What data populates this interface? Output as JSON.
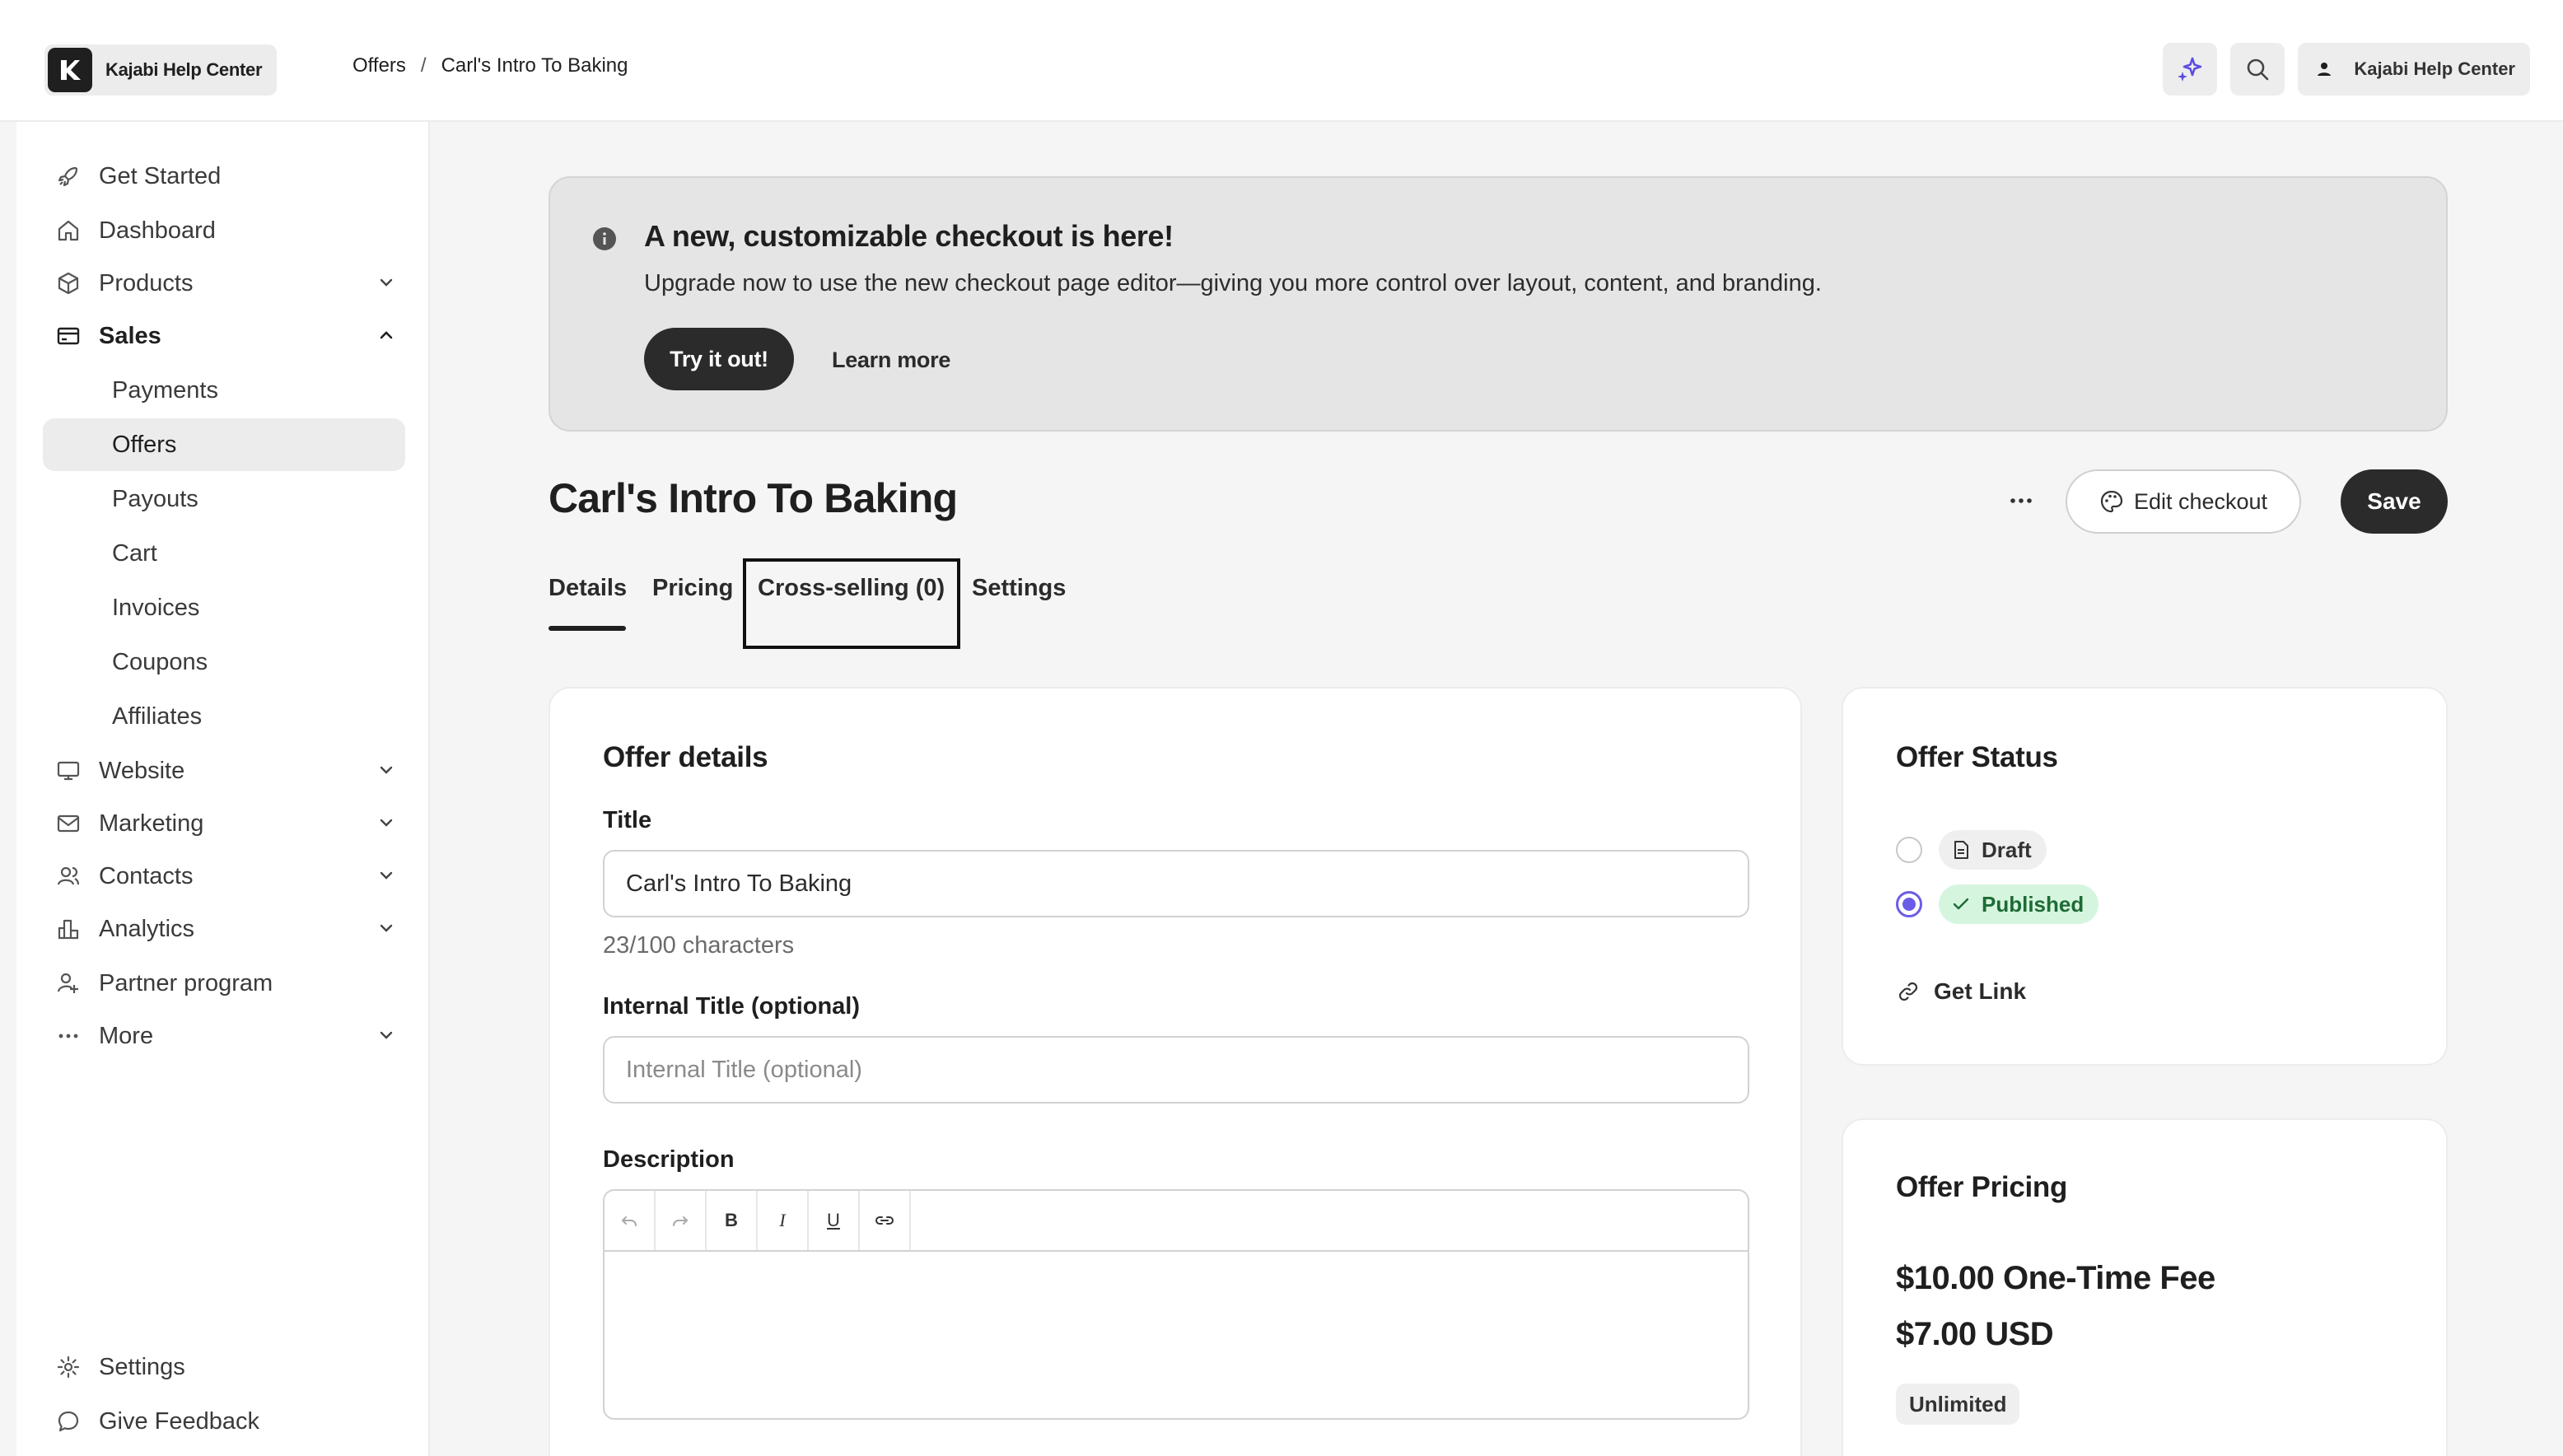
{
  "header": {
    "brand": "Kajabi Help Center",
    "breadcrumb": {
      "parent": "Offers",
      "separator": "/",
      "current": "Carl's Intro To Baking"
    },
    "account_label": "Kajabi Help Center",
    "icons": [
      "sparkle-icon",
      "search-icon",
      "user-icon"
    ]
  },
  "sidebar": {
    "items": [
      {
        "label": "Get Started",
        "icon": "rocket-icon"
      },
      {
        "label": "Dashboard",
        "icon": "home-icon"
      },
      {
        "label": "Products",
        "icon": "box-icon"
      },
      {
        "label": "Sales",
        "icon": "card-icon"
      },
      {
        "label": "Payments"
      },
      {
        "label": "Offers"
      },
      {
        "label": "Payouts"
      },
      {
        "label": "Cart"
      },
      {
        "label": "Invoices"
      },
      {
        "label": "Coupons"
      },
      {
        "label": "Affiliates"
      },
      {
        "label": "Website",
        "icon": "monitor-icon"
      },
      {
        "label": "Marketing",
        "icon": "mail-icon"
      },
      {
        "label": "Contacts",
        "icon": "contacts-icon"
      },
      {
        "label": "Analytics",
        "icon": "chart-icon"
      },
      {
        "label": "Partner program",
        "icon": "partner-icon"
      },
      {
        "label": "More",
        "icon": "dots-icon"
      }
    ],
    "bottom": [
      {
        "label": "Settings",
        "icon": "gear-icon"
      },
      {
        "label": "Give Feedback",
        "icon": "chat-icon"
      }
    ]
  },
  "banner": {
    "title": "A new, customizable checkout is here!",
    "text": "Upgrade now to use the new checkout page editor—giving you more control over layout, content, and branding.",
    "primary": "Try it out!",
    "secondary": "Learn more"
  },
  "page": {
    "title": "Carl's Intro To Baking",
    "edit_checkout": "Edit checkout",
    "save": "Save",
    "tabs": [
      "Details",
      "Pricing",
      "Cross-selling (0)",
      "Settings"
    ]
  },
  "offer_details": {
    "heading": "Offer details",
    "title_label": "Title",
    "title_value": "Carl's Intro To Baking",
    "char_count": "23/100 characters",
    "internal_label": "Internal Title (optional)",
    "internal_placeholder": "Internal Title (optional)",
    "description_label": "Description",
    "toolbar": [
      "undo",
      "redo",
      "B",
      "I",
      "U",
      "link"
    ]
  },
  "offer_status": {
    "heading": "Offer Status",
    "draft": "Draft",
    "published": "Published",
    "selected": "Published",
    "get_link": "Get Link"
  },
  "offer_pricing": {
    "heading": "Offer Pricing",
    "fee": "$10.00 One-Time Fee",
    "amount": "$7.00 USD",
    "badge": "Unlimited"
  },
  "colors": {
    "accent": "#6b5ce7",
    "dark": "#2b2b2b",
    "success_bg": "#d6f5df",
    "success_text": "#1d6b35"
  }
}
